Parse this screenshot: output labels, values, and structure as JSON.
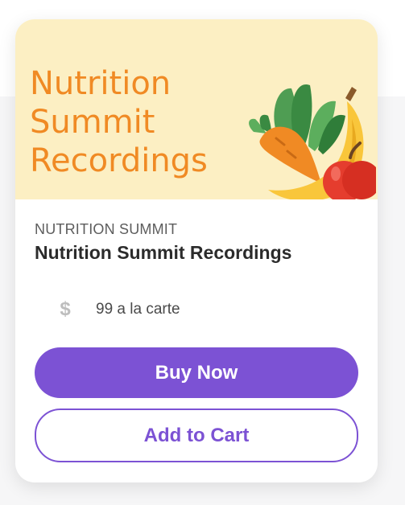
{
  "hero": {
    "title_lines": [
      "Nutrition",
      "Summit",
      "Recordings"
    ]
  },
  "product": {
    "category": "NUTRITION SUMMIT",
    "title": "Nutrition Summit Recordings",
    "price_icon": "dollar-icon",
    "price_text": "99 a la carte"
  },
  "actions": {
    "buy_label": "Buy Now",
    "cart_label": "Add to Cart"
  },
  "colors": {
    "accent": "#7c52d4",
    "hero_background": "#fcefc3",
    "hero_text": "#f08a24"
  }
}
